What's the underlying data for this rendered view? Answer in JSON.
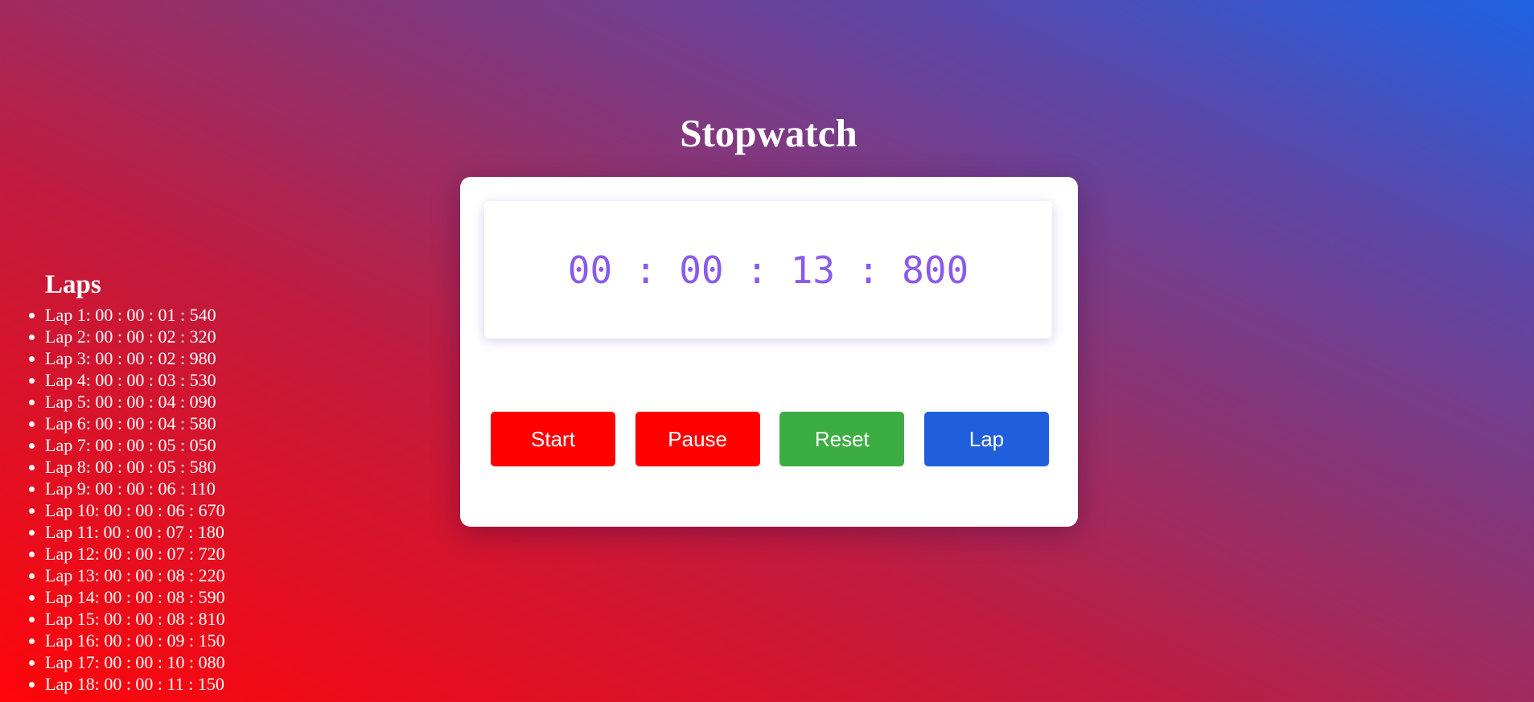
{
  "app": {
    "title": "Stopwatch"
  },
  "display": {
    "time": "00 : 00 : 13 : 800",
    "color": "#8a5bea"
  },
  "controls": {
    "start": {
      "label": "Start",
      "color": "#ff0000"
    },
    "pause": {
      "label": "Pause",
      "color": "#ff0000"
    },
    "reset": {
      "label": "Reset",
      "color": "#3cad42"
    },
    "lap": {
      "label": "Lap",
      "color": "#1f5fdc"
    }
  },
  "laps": {
    "title": "Laps",
    "items": [
      "Lap 1: 00 : 00 : 01 : 540",
      "Lap 2: 00 : 00 : 02 : 320",
      "Lap 3: 00 : 00 : 02 : 980",
      "Lap 4: 00 : 00 : 03 : 530",
      "Lap 5: 00 : 00 : 04 : 090",
      "Lap 6: 00 : 00 : 04 : 580",
      "Lap 7: 00 : 00 : 05 : 050",
      "Lap 8: 00 : 00 : 05 : 580",
      "Lap 9: 00 : 00 : 06 : 110",
      "Lap 10: 00 : 00 : 06 : 670",
      "Lap 11: 00 : 00 : 07 : 180",
      "Lap 12: 00 : 00 : 07 : 720",
      "Lap 13: 00 : 00 : 08 : 220",
      "Lap 14: 00 : 00 : 08 : 590",
      "Lap 15: 00 : 00 : 08 : 810",
      "Lap 16: 00 : 00 : 09 : 150",
      "Lap 17: 00 : 00 : 10 : 080",
      "Lap 18: 00 : 00 : 11 : 150"
    ]
  },
  "theme": {
    "gradient_start": "#ff0509",
    "gradient_end": "#1e63e6"
  }
}
